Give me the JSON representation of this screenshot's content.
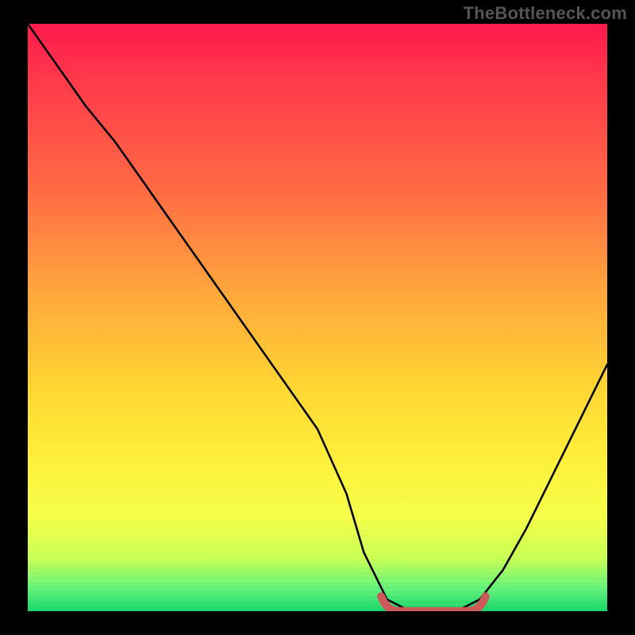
{
  "watermark": "TheBottleneck.com",
  "chart_data": {
    "type": "line",
    "title": "",
    "xlabel": "",
    "ylabel": "",
    "xlim": [
      0,
      100
    ],
    "ylim": [
      0,
      100
    ],
    "grid": false,
    "series": [
      {
        "name": "bottleneck-curve",
        "color": "#000000",
        "x": [
          0,
          5,
          10,
          15,
          20,
          25,
          30,
          35,
          40,
          45,
          50,
          55,
          58,
          62,
          66,
          70,
          74,
          78,
          82,
          86,
          90,
          94,
          98,
          100
        ],
        "values": [
          100,
          93,
          86,
          80,
          73,
          66,
          59,
          52,
          45,
          38,
          31,
          20,
          10,
          2,
          0,
          0,
          0,
          2,
          7,
          14,
          22,
          30,
          38,
          42
        ]
      }
    ],
    "annotations": [
      {
        "name": "flat-bottom-marker",
        "color": "#cc5a5a",
        "shape": "round-rect",
        "x_range": [
          62,
          78
        ],
        "y": 0,
        "note": "highlighted optimal zone at curve minimum"
      }
    ],
    "background_gradient_stops": [
      {
        "pos": 0.0,
        "color": "#ff1a4d"
      },
      {
        "pos": 0.28,
        "color": "#ff6a44"
      },
      {
        "pos": 0.62,
        "color": "#ffd633"
      },
      {
        "pos": 0.84,
        "color": "#f6ff4a"
      },
      {
        "pos": 1.0,
        "color": "#18d66a"
      }
    ]
  }
}
